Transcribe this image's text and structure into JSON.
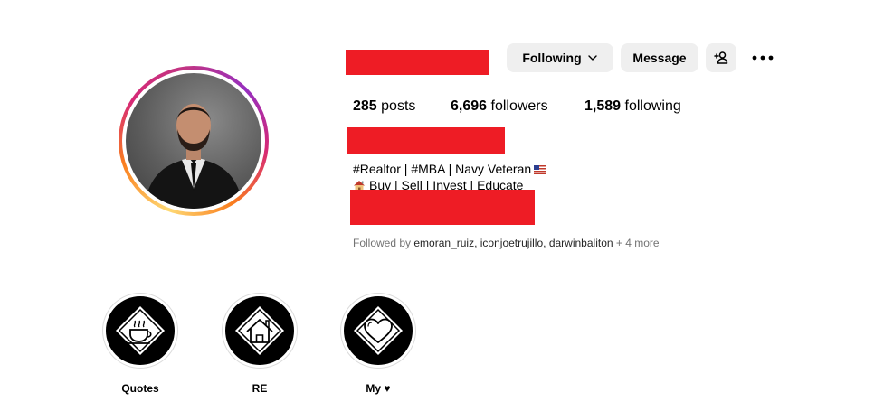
{
  "profile": {
    "buttons": {
      "following_label": "Following",
      "message_label": "Message"
    },
    "stats": {
      "posts_count": "285",
      "posts_label": "posts",
      "followers_count": "6,696",
      "followers_label": "followers",
      "following_count": "1,589",
      "following_label": "following"
    },
    "bio": {
      "line1": "#Realtor | #MBA | Navy Veteran",
      "line2": "Buy | Sell | Invest | Educate"
    },
    "followed_by": {
      "prefix": "Followed by",
      "user1": "emoran_ruiz",
      "user2": "iconjoetrujillo",
      "user3": "darwinbaliton",
      "more": "+ 4 more"
    }
  },
  "highlights": [
    {
      "label": "Quotes",
      "icon": "coffee-cup-icon"
    },
    {
      "label": "RE",
      "icon": "house-icon"
    },
    {
      "label": "My ♥",
      "icon": "heart-icon"
    }
  ],
  "colors": {
    "redaction": "#ee1c25",
    "button_bg": "#efefef",
    "muted_text": "#737373"
  }
}
